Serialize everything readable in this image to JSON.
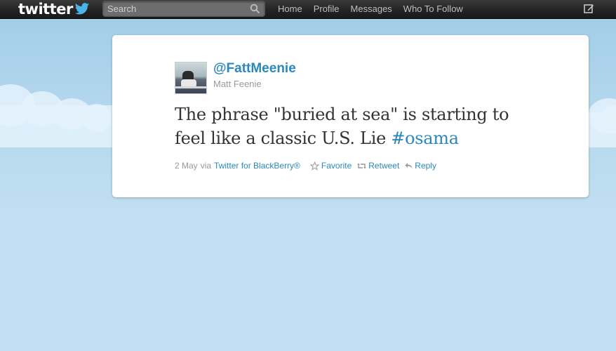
{
  "topbar": {
    "logo_text": "twitter",
    "search_placeholder": "Search",
    "nav": [
      {
        "label": "Home"
      },
      {
        "label": "Profile"
      },
      {
        "label": "Messages"
      },
      {
        "label": "Who To Follow"
      }
    ]
  },
  "tweet": {
    "handle": "@FattMeenie",
    "full_name": "Matt Feenie",
    "text_line1": "The phrase \"buried at sea\" is starting to",
    "text_line2": "feel like a classic U.S. Lie ",
    "hashtag": "#osama",
    "date": "2 May",
    "via": "via",
    "source": "Twitter for BlackBerry®",
    "actions": {
      "favorite": "Favorite",
      "retweet": "Retweet",
      "reply": "Reply"
    }
  },
  "colors": {
    "link": "#2a88bd",
    "topbar": "#222222",
    "background": "#c0dff0"
  },
  "icons": [
    "bird-icon",
    "search-icon",
    "compose-icon",
    "star-icon",
    "retweet-icon",
    "reply-icon"
  ]
}
